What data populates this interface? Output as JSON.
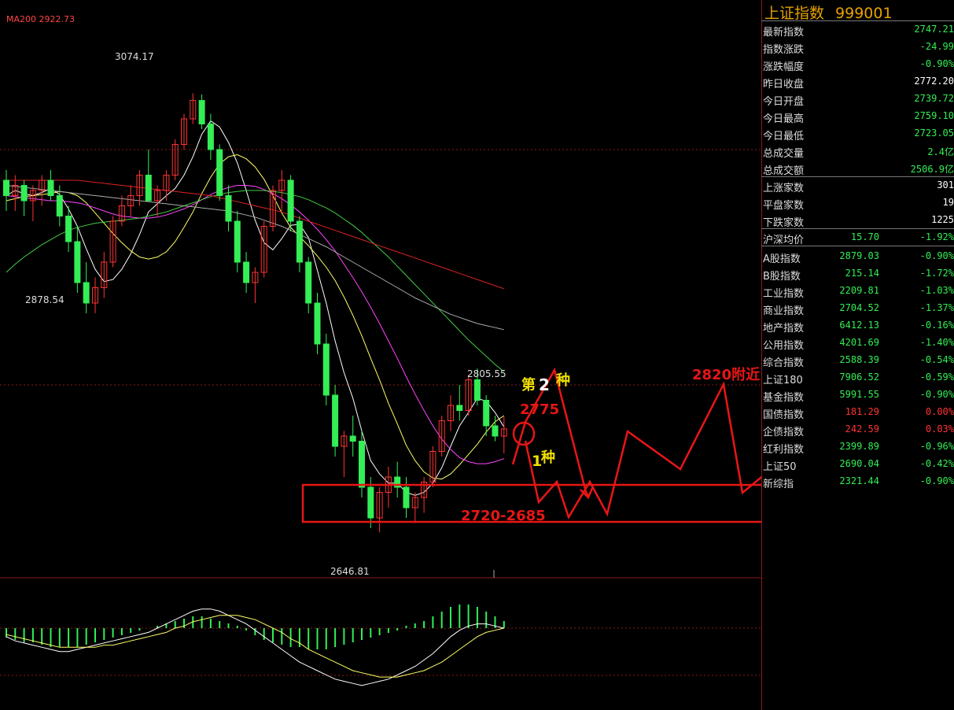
{
  "ma200_label": "MA200 2922.73",
  "annotations": {
    "high_label": "3074.17",
    "low_label_left": "2878.54",
    "low_label_bottom": "2646.81",
    "mid_high_label": "2805.55",
    "text_2820": "2820附近",
    "text_2775": "2775",
    "text_range": "2720-2685",
    "text_second_type_a": "第",
    "text_second_type_b": "2",
    "text_second_type_c": "种",
    "text_first_type_a": "1",
    "text_first_type_b": "种"
  },
  "colors": {
    "up": "#ff3333",
    "down": "#33ee55",
    "red_line": "#e81616",
    "label": "#dddddd",
    "title": "#e6a100",
    "panel_border": "#8b1a1a"
  },
  "sidebar": {
    "title": "上证指数",
    "code": "999001",
    "quote": [
      {
        "label": "最新指数",
        "value": "2747.21",
        "tone": "down"
      },
      {
        "label": "指数涨跌",
        "value": "-24.99",
        "tone": "down"
      },
      {
        "label": "涨跌幅度",
        "value": "-0.90%",
        "tone": "down"
      },
      {
        "label": "昨日收盘",
        "value": "2772.20",
        "tone": "neutral"
      },
      {
        "label": "今日开盘",
        "value": "2739.72",
        "tone": "down"
      },
      {
        "label": "今日最高",
        "value": "2759.10",
        "tone": "down"
      },
      {
        "label": "今日最低",
        "value": "2723.05",
        "tone": "down"
      },
      {
        "label": "总成交量",
        "value": "2.4亿",
        "tone": "down"
      },
      {
        "label": "总成交额",
        "value": "2506.9亿",
        "tone": "down"
      }
    ],
    "breadth": [
      {
        "label": "上涨家数",
        "value": "301",
        "tone": "neutral"
      },
      {
        "label": "平盘家数",
        "value": "19",
        "tone": "neutral"
      },
      {
        "label": "下跌家数",
        "value": "1225",
        "tone": "neutral"
      }
    ],
    "avg": {
      "label": "沪深均价",
      "value": "15.70",
      "change": "-1.92%"
    },
    "indices": [
      {
        "label": "A股指数",
        "value": "2879.03",
        "change": "-0.90%",
        "vtone": "down",
        "ctone": "down"
      },
      {
        "label": "B股指数",
        "value": "215.14",
        "change": "-1.72%",
        "vtone": "down",
        "ctone": "down"
      },
      {
        "label": "工业指数",
        "value": "2209.81",
        "change": "-1.03%",
        "vtone": "down",
        "ctone": "down"
      },
      {
        "label": "商业指数",
        "value": "2704.52",
        "change": "-1.37%",
        "vtone": "down",
        "ctone": "down"
      },
      {
        "label": "地产指数",
        "value": "6412.13",
        "change": "-0.16%",
        "vtone": "down",
        "ctone": "down"
      },
      {
        "label": "公用指数",
        "value": "4201.69",
        "change": "-1.40%",
        "vtone": "down",
        "ctone": "down"
      },
      {
        "label": "综合指数",
        "value": "2588.39",
        "change": "-0.54%",
        "vtone": "down",
        "ctone": "down"
      },
      {
        "label": "上证180",
        "value": "7906.52",
        "change": "-0.59%",
        "vtone": "down",
        "ctone": "down"
      },
      {
        "label": "基金指数",
        "value": "5991.55",
        "change": "-0.90%",
        "vtone": "down",
        "ctone": "down"
      },
      {
        "label": "国债指数",
        "value": "181.29",
        "change": "0.00%",
        "vtone": "up",
        "ctone": "up"
      },
      {
        "label": "企债指数",
        "value": "242.59",
        "change": "0.03%",
        "vtone": "up",
        "ctone": "up"
      },
      {
        "label": "红利指数",
        "value": "2399.89",
        "change": "-0.96%",
        "vtone": "down",
        "ctone": "down"
      },
      {
        "label": "上证50",
        "value": "2690.04",
        "change": "-0.42%",
        "vtone": "down",
        "ctone": "down"
      },
      {
        "label": "新综指",
        "value": "2321.44",
        "change": "-0.90%",
        "vtone": "down",
        "ctone": "down"
      }
    ]
  },
  "chart_data": {
    "type": "candlestick",
    "price_range": [
      2620,
      3120
    ],
    "candles": [
      [
        2990,
        3000,
        2960,
        2975
      ],
      [
        2975,
        2995,
        2960,
        2985
      ],
      [
        2985,
        2990,
        2955,
        2970
      ],
      [
        2970,
        2985,
        2950,
        2980
      ],
      [
        2980,
        2995,
        2965,
        2990
      ],
      [
        2990,
        3000,
        2970,
        2975
      ],
      [
        2975,
        2985,
        2945,
        2955
      ],
      [
        2955,
        2965,
        2920,
        2930
      ],
      [
        2930,
        2945,
        2880,
        2890
      ],
      [
        2890,
        2910,
        2860,
        2870
      ],
      [
        2870,
        2895,
        2860,
        2885
      ],
      [
        2885,
        2920,
        2875,
        2910
      ],
      [
        2910,
        2955,
        2905,
        2950
      ],
      [
        2950,
        2975,
        2945,
        2965
      ],
      [
        2965,
        2985,
        2955,
        2975
      ],
      [
        2975,
        3000,
        2965,
        2995
      ],
      [
        2995,
        3020,
        2985,
        2970
      ],
      [
        2970,
        2985,
        2955,
        2980
      ],
      [
        2980,
        3000,
        2970,
        2995
      ],
      [
        2995,
        3030,
        2990,
        3025
      ],
      [
        3025,
        3055,
        3020,
        3050
      ],
      [
        3050,
        3075,
        3045,
        3068
      ],
      [
        3068,
        3074,
        3040,
        3045
      ],
      [
        3045,
        3055,
        3010,
        3020
      ],
      [
        3020,
        3025,
        2970,
        2975
      ],
      [
        2975,
        2985,
        2940,
        2950
      ],
      [
        2950,
        2960,
        2900,
        2910
      ],
      [
        2910,
        2920,
        2880,
        2890
      ],
      [
        2890,
        2905,
        2870,
        2900
      ],
      [
        2900,
        2950,
        2895,
        2945
      ],
      [
        2945,
        2985,
        2940,
        2980
      ],
      [
        2980,
        3000,
        2960,
        2990
      ],
      [
        2990,
        2995,
        2940,
        2950
      ],
      [
        2950,
        2955,
        2900,
        2910
      ],
      [
        2910,
        2915,
        2860,
        2870
      ],
      [
        2870,
        2880,
        2820,
        2830
      ],
      [
        2830,
        2840,
        2770,
        2780
      ],
      [
        2780,
        2790,
        2720,
        2730
      ],
      [
        2730,
        2745,
        2700,
        2740
      ],
      [
        2740,
        2760,
        2720,
        2735
      ],
      [
        2735,
        2745,
        2680,
        2690
      ],
      [
        2690,
        2700,
        2650,
        2660
      ],
      [
        2660,
        2690,
        2646,
        2685
      ],
      [
        2685,
        2710,
        2670,
        2700
      ],
      [
        2700,
        2715,
        2680,
        2690
      ],
      [
        2690,
        2700,
        2660,
        2670
      ],
      [
        2670,
        2685,
        2655,
        2680
      ],
      [
        2680,
        2700,
        2665,
        2695
      ],
      [
        2695,
        2730,
        2690,
        2725
      ],
      [
        2725,
        2760,
        2720,
        2755
      ],
      [
        2755,
        2780,
        2745,
        2770
      ],
      [
        2770,
        2790,
        2755,
        2765
      ],
      [
        2765,
        2800,
        2760,
        2795
      ],
      [
        2795,
        2806,
        2770,
        2775
      ],
      [
        2775,
        2780,
        2740,
        2750
      ],
      [
        2750,
        2760,
        2735,
        2740
      ],
      [
        2740,
        2759,
        2723,
        2747
      ]
    ],
    "ma_series": [
      {
        "color": "#ffffff",
        "values": [
          2975,
          2980,
          2977,
          2975,
          2978,
          2982,
          2976,
          2962,
          2945,
          2923,
          2903,
          2891,
          2893,
          2903,
          2918,
          2937,
          2959,
          2967,
          2975,
          2982,
          2995,
          3013,
          3035,
          3048,
          3042,
          3027,
          3007,
          2980,
          2951,
          2929,
          2922,
          2933,
          2946,
          2947,
          2934,
          2902,
          2870,
          2833,
          2802,
          2777,
          2745,
          2716,
          2703,
          2694,
          2694,
          2685,
          2682,
          2685,
          2694,
          2709,
          2730,
          2750,
          2763,
          2777,
          2774,
          2763,
          2749
        ]
      },
      {
        "color": "#ffff66",
        "values": [
          2970,
          2972,
          2974,
          2975,
          2976,
          2977,
          2979,
          2978,
          2975,
          2968,
          2958,
          2948,
          2938,
          2929,
          2921,
          2915,
          2913,
          2915,
          2920,
          2930,
          2944,
          2959,
          2977,
          2993,
          3006,
          3013,
          3015,
          3011,
          3003,
          2991,
          2975,
          2958,
          2944,
          2935,
          2926,
          2916,
          2905,
          2892,
          2876,
          2858,
          2838,
          2816,
          2795,
          2772,
          2752,
          2731,
          2716,
          2705,
          2699,
          2698,
          2703,
          2712,
          2722,
          2732,
          2744,
          2754,
          2760
        ]
      },
      {
        "color": "#ff44ff",
        "values": [
          2975,
          2974,
          2973,
          2972,
          2971,
          2970,
          2970,
          2969,
          2968,
          2966,
          2963,
          2960,
          2957,
          2955,
          2954,
          2953,
          2953,
          2954,
          2956,
          2959,
          2962,
          2966,
          2971,
          2976,
          2980,
          2983,
          2985,
          2985,
          2984,
          2981,
          2977,
          2972,
          2966,
          2959,
          2951,
          2942,
          2932,
          2921,
          2908,
          2895,
          2881,
          2866,
          2850,
          2833,
          2816,
          2798,
          2781,
          2765,
          2750,
          2737,
          2727,
          2719,
          2715,
          2713,
          2713,
          2715,
          2718
        ]
      },
      {
        "color": "#44cc44",
        "values": [
          2900,
          2908,
          2915,
          2921,
          2927,
          2932,
          2937,
          2941,
          2944,
          2946,
          2948,
          2949,
          2950,
          2951,
          2952,
          2953,
          2955,
          2957,
          2959,
          2962,
          2965,
          2968,
          2971,
          2974,
          2976,
          2978,
          2979,
          2980,
          2980,
          2980,
          2979,
          2978,
          2976,
          2974,
          2971,
          2967,
          2963,
          2958,
          2952,
          2946,
          2939,
          2931,
          2923,
          2915,
          2906,
          2897,
          2888,
          2879,
          2870,
          2861,
          2852,
          2843,
          2834,
          2826,
          2818,
          2810,
          2803
        ]
      },
      {
        "color": "#aaaaaa",
        "values": [
          2985,
          2984,
          2983,
          2982,
          2981,
          2980,
          2979,
          2978,
          2977,
          2976,
          2975,
          2974,
          2973,
          2972,
          2971,
          2970,
          2969,
          2968,
          2967,
          2966,
          2965,
          2964,
          2963,
          2962,
          2961,
          2960,
          2958,
          2956,
          2954,
          2951,
          2948,
          2945,
          2941,
          2937,
          2933,
          2929,
          2925,
          2920,
          2915,
          2910,
          2905,
          2900,
          2895,
          2890,
          2885,
          2880,
          2875,
          2871,
          2867,
          2863,
          2859,
          2856,
          2853,
          2850,
          2848,
          2846,
          2844
        ]
      },
      {
        "color": "#dd2222",
        "values": [
          2990,
          2990,
          2990,
          2990,
          2990,
          2990,
          2990,
          2990,
          2990,
          2989,
          2988,
          2987,
          2986,
          2985,
          2984,
          2983,
          2982,
          2981,
          2980,
          2979,
          2978,
          2977,
          2976,
          2975,
          2973,
          2971,
          2969,
          2967,
          2965,
          2963,
          2961,
          2959,
          2956,
          2953,
          2950,
          2947,
          2944,
          2941,
          2938,
          2935,
          2932,
          2929,
          2926,
          2923,
          2920,
          2917,
          2914,
          2911,
          2908,
          2905,
          2902,
          2899,
          2896,
          2893,
          2890,
          2887,
          2884
        ]
      }
    ],
    "macd_histogram": [
      -4,
      -5,
      -6,
      -6,
      -7,
      -8,
      -8,
      -8,
      -8,
      -7,
      -6,
      -5,
      -4,
      -3,
      -2,
      -1,
      0,
      1,
      2,
      3,
      4,
      5,
      5,
      4,
      3,
      2,
      1,
      -1,
      -3,
      -5,
      -6,
      -7,
      -8,
      -8,
      -9,
      -9,
      -9,
      -8,
      -7,
      -6,
      -5,
      -4,
      -3,
      -2,
      -1,
      1,
      2,
      3,
      5,
      7,
      9,
      10,
      10,
      9,
      7,
      5,
      3
    ],
    "macd_dif": [
      -4,
      -6,
      -7,
      -8,
      -9,
      -10,
      -11,
      -11,
      -10,
      -9,
      -8,
      -7,
      -6,
      -5,
      -4,
      -3,
      -2,
      0,
      2,
      4,
      6,
      8,
      9,
      9,
      8,
      6,
      4,
      2,
      -1,
      -4,
      -7,
      -10,
      -13,
      -16,
      -18,
      -20,
      -22,
      -24,
      -25,
      -26,
      -27,
      -26,
      -25,
      -24,
      -22,
      -20,
      -18,
      -15,
      -12,
      -8,
      -4,
      -1,
      1,
      2,
      2,
      1,
      0
    ],
    "macd_dea": [
      -3,
      -4,
      -5,
      -6,
      -7,
      -8,
      -9,
      -9,
      -9,
      -9,
      -9,
      -8,
      -8,
      -7,
      -6,
      -5,
      -4,
      -3,
      -2,
      0,
      1,
      3,
      4,
      5,
      6,
      6,
      6,
      5,
      4,
      2,
      0,
      -2,
      -5,
      -7,
      -10,
      -12,
      -14,
      -16,
      -18,
      -20,
      -21,
      -22,
      -23,
      -23,
      -23,
      -22,
      -21,
      -20,
      -18,
      -16,
      -13,
      -10,
      -7,
      -4,
      -2,
      -1,
      0
    ]
  }
}
